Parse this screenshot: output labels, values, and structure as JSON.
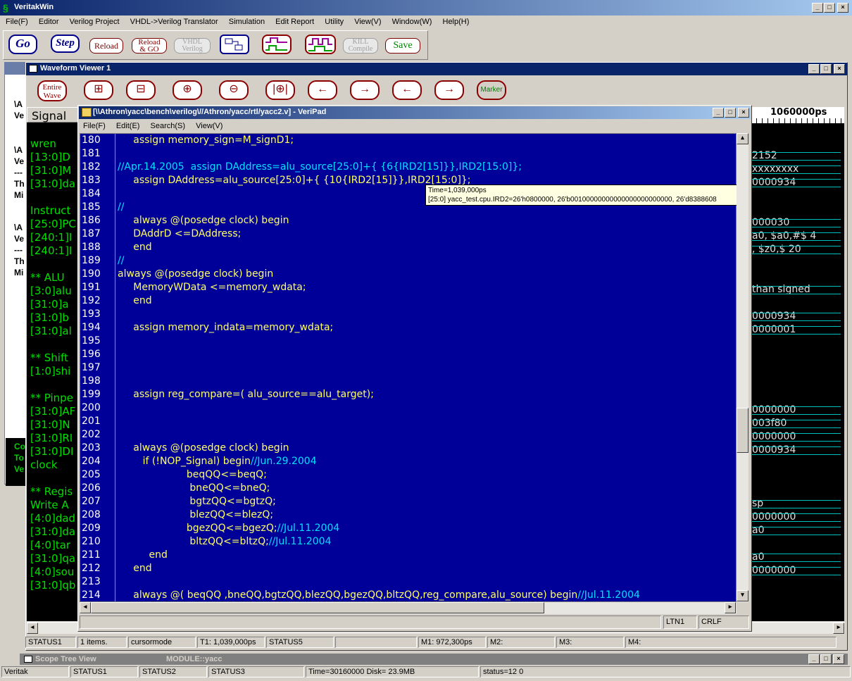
{
  "main_window": {
    "title": "VeritakWin",
    "menu": [
      "File(F)",
      "Editor",
      "Verilog Project",
      "VHDL->Verilog Translator",
      "Simulation",
      "Edit Report",
      "Utility",
      "View(V)",
      "Window(W)",
      "Help(H)"
    ],
    "toolbar": {
      "go": "Go",
      "step": "Step",
      "reload": "Reload",
      "reload_go_1": "Reload",
      "reload_go_2": "& GO",
      "vhdl_1": "VHDL",
      "vhdl_2": "Verilog",
      "kill_1": "KILL",
      "kill_2": "Compile",
      "save": "Save"
    }
  },
  "waveform": {
    "title": "Waveform Viewer 1",
    "entire_1": "Entire",
    "entire_2": "Wave",
    "marker": "Marker",
    "signal_header": "Signal",
    "time_label": "1060000ps",
    "signals": [
      "wren",
      "[13:0]D",
      "[31:0]M",
      "[31:0]da",
      "",
      "Instruct",
      "[25:0]PC",
      "[240:1]I",
      "[240:1]I",
      "",
      "** ALU",
      "[3:0]alu",
      "[31:0]a",
      "[31:0]b",
      "[31:0]al",
      "",
      "** Shift",
      "[1:0]shi",
      "",
      "** Pinpe",
      "[31:0]AF",
      "[31:0]N",
      "[31:0]RI",
      "[31:0]DI",
      "clock",
      "",
      "** Regis",
      "Write A",
      "[4:0]dad",
      "[31:0]da",
      "[4:0]tar",
      "[31:0]qa",
      "[4:0]sou",
      "[31:0]qb"
    ],
    "wave_values": [
      "",
      "2152",
      "xxxxxxxx",
      "0000934",
      "",
      "",
      "000030",
      "a0, $a0,#$  4",
      ", $z0,$   20",
      "",
      "",
      "than  signed",
      "",
      "0000934",
      "0000001",
      "",
      "",
      "",
      "",
      "",
      "0000000",
      "003f80",
      "0000000",
      "0000934",
      "",
      "",
      "",
      "sp",
      "0000000",
      "a0",
      "",
      "a0",
      "0000000"
    ],
    "left_fragments": [
      "\\A",
      "Ve",
      "\\A",
      "Ve",
      "---",
      "Th",
      "Mi",
      "\\A",
      "Ve",
      "---",
      "Th",
      "Mi"
    ],
    "green_fragments": [
      "Co",
      "To",
      "Ve"
    ]
  },
  "veripad": {
    "title": "[\\\\Athron\\yacc\\bench\\verilog\\//Athron/yacc/rtl/yacc2.v] - VeriPad",
    "menu": [
      "File(F)",
      "Edit(E)",
      "Search(S)",
      "View(V)"
    ],
    "lines": [
      {
        "n": "180",
        "t": "     assign memory_sign=M_signD1;",
        "c": ""
      },
      {
        "n": "181",
        "t": "",
        "c": ""
      },
      {
        "n": "182",
        "t": "",
        "c": "//Apr.14.2005  assign DAddress=alu_source[25:0]+{ {6{IRD2[15]}},IRD2[15:0]};"
      },
      {
        "n": "183",
        "t": "     assign DAddress=alu_source[25:0]+{ {10{IRD2[15]}},IRD2[15:0]};",
        "c": ""
      },
      {
        "n": "184",
        "t": "",
        "c": ""
      },
      {
        "n": "185",
        "t": "",
        "c": "//"
      },
      {
        "n": "186",
        "t": "     always @(posedge clock) begin",
        "c": ""
      },
      {
        "n": "187",
        "t": "     DAddrD <=DAddress;",
        "c": ""
      },
      {
        "n": "188",
        "t": "     end",
        "c": ""
      },
      {
        "n": "189",
        "t": "",
        "c": "//"
      },
      {
        "n": "190",
        "t": "always @(posedge clock) begin",
        "c": ""
      },
      {
        "n": "191",
        "t": "     MemoryWData <=memory_wdata;",
        "c": ""
      },
      {
        "n": "192",
        "t": "     end",
        "c": ""
      },
      {
        "n": "193",
        "t": "",
        "c": ""
      },
      {
        "n": "194",
        "t": "     assign memory_indata=memory_wdata;",
        "c": ""
      },
      {
        "n": "195",
        "t": "",
        "c": ""
      },
      {
        "n": "196",
        "t": "",
        "c": ""
      },
      {
        "n": "197",
        "t": "",
        "c": ""
      },
      {
        "n": "198",
        "t": "",
        "c": ""
      },
      {
        "n": "199",
        "t": "     assign reg_compare=( alu_source==alu_target);",
        "c": ""
      },
      {
        "n": "200",
        "t": "",
        "c": ""
      },
      {
        "n": "201",
        "t": "",
        "c": ""
      },
      {
        "n": "202",
        "t": "",
        "c": ""
      },
      {
        "n": "203",
        "t": "     always @(posedge clock) begin",
        "c": ""
      },
      {
        "n": "204",
        "t": "        if (!NOP_Signal) begin",
        "c": "//Jun.29.2004"
      },
      {
        "n": "205",
        "t": "                      beqQQ<=beqQ;",
        "c": ""
      },
      {
        "n": "206",
        "t": "                       bneQQ<=bneQ;",
        "c": ""
      },
      {
        "n": "207",
        "t": "                       bgtzQQ<=bgtzQ;",
        "c": ""
      },
      {
        "n": "208",
        "t": "                       blezQQ<=blezQ;",
        "c": ""
      },
      {
        "n": "209",
        "t": "                      bgezQQ<=bgezQ;",
        "c": "//Jul.11.2004"
      },
      {
        "n": "210",
        "t": "                       bltzQQ<=bltzQ;",
        "c": "//Jul.11.2004"
      },
      {
        "n": "211",
        "t": "          end",
        "c": ""
      },
      {
        "n": "212",
        "t": "     end",
        "c": ""
      },
      {
        "n": "213",
        "t": "",
        "c": ""
      },
      {
        "n": "214",
        "t": "     always @( beqQQ ,bneQQ,bgtzQQ,blezQQ,bgezQQ,bltzQQ,reg_compare,alu_source) begin",
        "c": "//Jul.11.2004"
      }
    ],
    "tooltip_1": "Time=1,039,000ps",
    "tooltip_2": "[25:0] yacc_test.cpu.IRD2=26'h0800000, 26'b00100000000000000000000000, 26'd8388608",
    "status_ltn": "LTN1",
    "status_crlf": "CRLF"
  },
  "wv_status": [
    "STATUS1",
    "1 items.",
    "cursormode",
    "T1: 1,039,000ps",
    "STATUS5",
    "",
    "M1: 972,300ps",
    "M2:",
    "M3:",
    "M4:"
  ],
  "scope_tree": {
    "title": "Scope Tree View",
    "module": "MODULE::yacc"
  },
  "main_status": [
    "Veritak",
    "STATUS1",
    "STATUS2",
    "STATUS3",
    "Time=30160000 Disk= 23.9MB",
    "status=12 0"
  ]
}
